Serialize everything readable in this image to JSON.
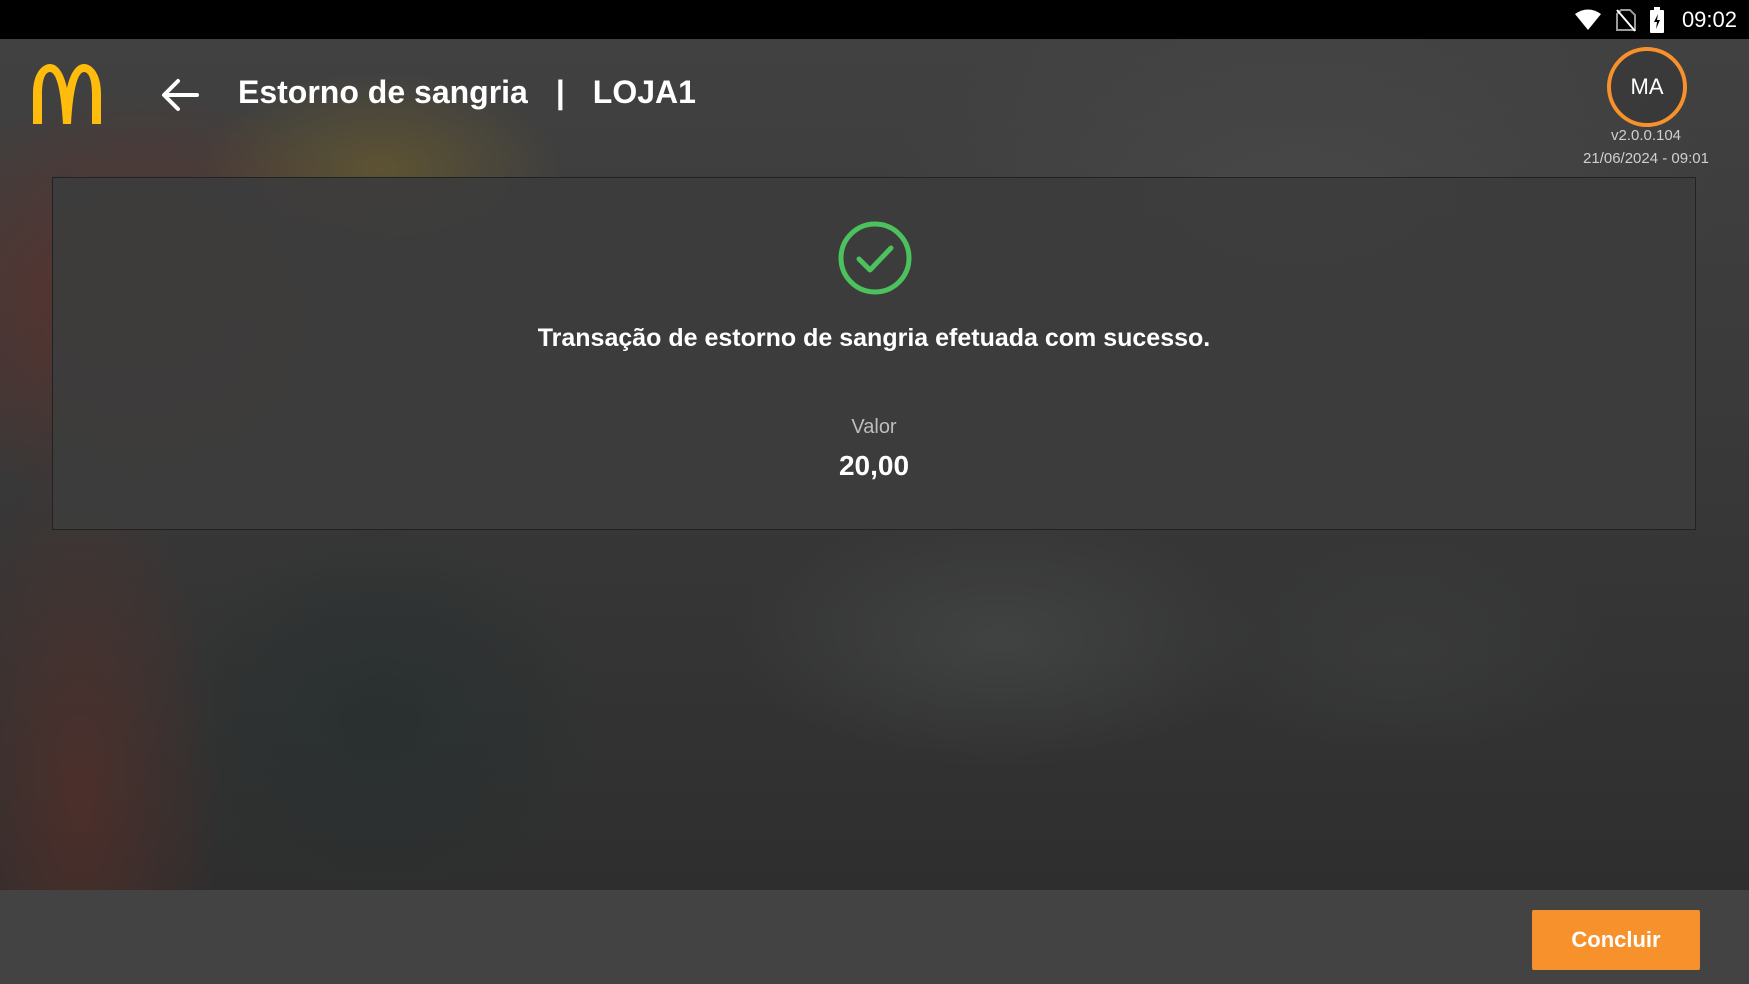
{
  "status_bar": {
    "time": "09:02",
    "icons": [
      "wifi-icon",
      "no-sim-icon",
      "battery-charging-icon"
    ]
  },
  "header": {
    "logo": "mcdonalds-logo",
    "back_icon": "arrow-left-icon",
    "title": "Estorno de sangria",
    "separator": "|",
    "store": "LOJA1",
    "avatar_initials": "MA",
    "version": "v2.0.0.104",
    "datetime": "21/06/2024 - 09:01"
  },
  "result": {
    "icon": "check-circle-icon",
    "message": "Transação de estorno de sangria efetuada com sucesso.",
    "value_label": "Valor",
    "value": "20,00"
  },
  "footer": {
    "done_label": "Concluir"
  },
  "colors": {
    "accent": "#f7912c",
    "success": "#4cc25e",
    "logo": "#ffbc0d"
  }
}
